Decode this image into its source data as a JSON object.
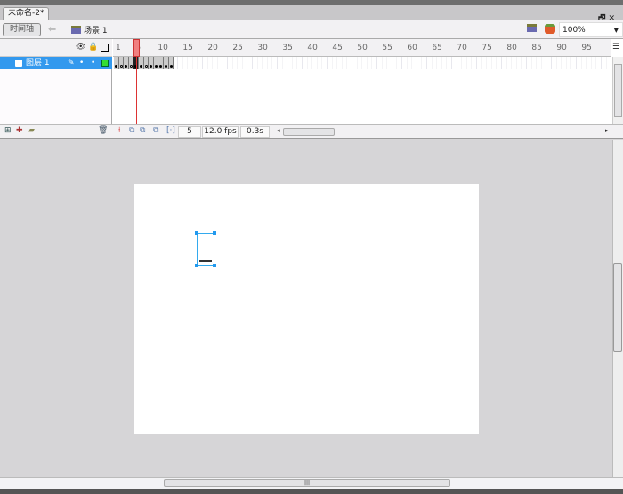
{
  "document_tab": {
    "title": "未命名-2*"
  },
  "window_controls": {
    "minimize": "_",
    "restore": "🗗",
    "close": "✕"
  },
  "toolbar": {
    "timeline_button": "时间轴",
    "back_icon": "arrow-left-icon",
    "scene_label": "场景 1",
    "zoom_value": "100%"
  },
  "timeline": {
    "header_icons": [
      "eye-icon",
      "lock-icon",
      "outline-icon"
    ],
    "ruler_ticks": [
      "1",
      "5",
      "10",
      "15",
      "20",
      "25",
      "30",
      "35",
      "40",
      "45",
      "50",
      "55",
      "60",
      "65",
      "70",
      "75",
      "80",
      "85",
      "90",
      "95"
    ],
    "layers": [
      {
        "name": "图层 1",
        "selected": true,
        "outline_color": "#33dd33"
      }
    ],
    "filled_frames": 12,
    "current_frame": "5",
    "frame_rate": "12.0 fps",
    "elapsed_time": "0.3s"
  },
  "colors": {
    "selection": "#3399ee",
    "playhead": "#dd3333",
    "stage_bg": "#d6d5d7"
  }
}
